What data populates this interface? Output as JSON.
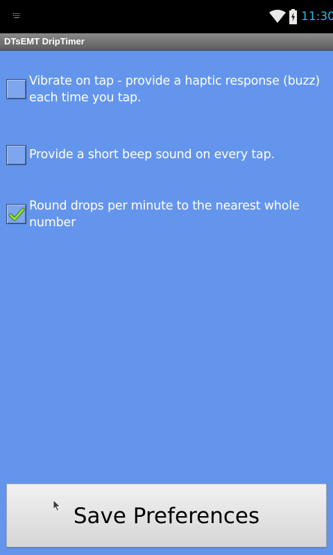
{
  "status_bar": {
    "time": "11:30",
    "icons": [
      "keyboard-icon",
      "wifi-icon",
      "battery-charging-icon"
    ],
    "time_color": "#33B5E5"
  },
  "title_bar": {
    "title": "DTsEMT DripTimer"
  },
  "preferences": [
    {
      "label": "Vibrate on tap - provide a haptic response (buzz) each time you tap.",
      "checked": false
    },
    {
      "label": "Provide a short beep sound on every tap.",
      "checked": false
    },
    {
      "label": "Round drops per minute to the nearest whole number",
      "checked": true
    }
  ],
  "save_button": {
    "label": "Save Preferences"
  },
  "colors": {
    "background": "#6495ED",
    "check_mark": "#7ED321"
  }
}
